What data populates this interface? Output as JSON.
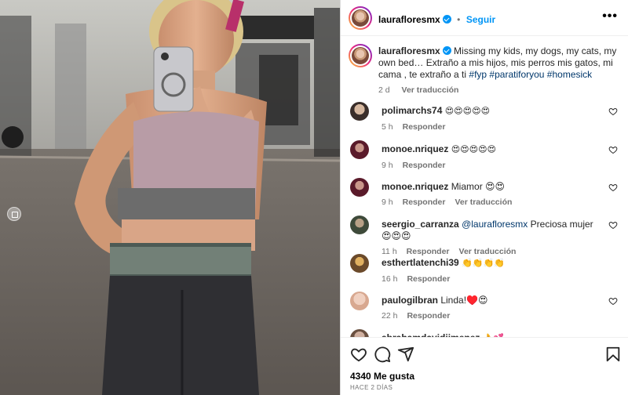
{
  "post": {
    "author": "laurafloresmx",
    "follow_label": "Seguir",
    "more_label": "•••",
    "caption_text": "Missing my kids, my dogs, my cats, my own bed… Extraño a mis hijos, mis perros mis gatos, mi cama , te extraño a ti",
    "hashtags": "#fyp #paratiforyou #homesick",
    "caption_age": "2 d",
    "caption_translate": "Ver traducción",
    "likes": "4340 Me gusta",
    "date": "HACE 2 DÍAS"
  },
  "comments": [
    {
      "user": "polimarchs74",
      "text": "😍😍😍😍😍",
      "age": "5 h",
      "reply": "Responder",
      "translate": ""
    },
    {
      "user": "monoe.nriquez",
      "text": "😍😍😍😍😍",
      "age": "9 h",
      "reply": "Responder",
      "translate": ""
    },
    {
      "user": "monoe.nriquez",
      "text": "Miamor 😍😍",
      "age": "9 h",
      "reply": "Responder",
      "translate": "Ver traducción"
    },
    {
      "user": "seergio_carranza",
      "mention": "@laurafloresmx",
      "text": "Preciosa mujer😍😍😍",
      "age": "11 h",
      "reply": "Responder",
      "translate": "Ver traducción"
    },
    {
      "user": "esthertlatenchi39",
      "text": "👏👏👏👏",
      "age": "16 h",
      "reply": "Responder",
      "translate": ""
    },
    {
      "user": "paulogilbran",
      "text": "Linda!♥️😍",
      "age": "22 h",
      "reply": "Responder",
      "translate": ""
    },
    {
      "user": "abrahamdavidjimenez",
      "text": "👌💕",
      "age": "",
      "reply": "",
      "translate": ""
    }
  ],
  "icons": {
    "like": "heart-icon",
    "comment": "comment-icon",
    "share": "share-icon",
    "save": "bookmark-icon",
    "more": "more-icon",
    "verified": "verified-badge-icon"
  },
  "colors": {
    "link": "#0095f6",
    "hashtag": "#00376b",
    "meta": "#737373",
    "heart": "#ed4956"
  }
}
